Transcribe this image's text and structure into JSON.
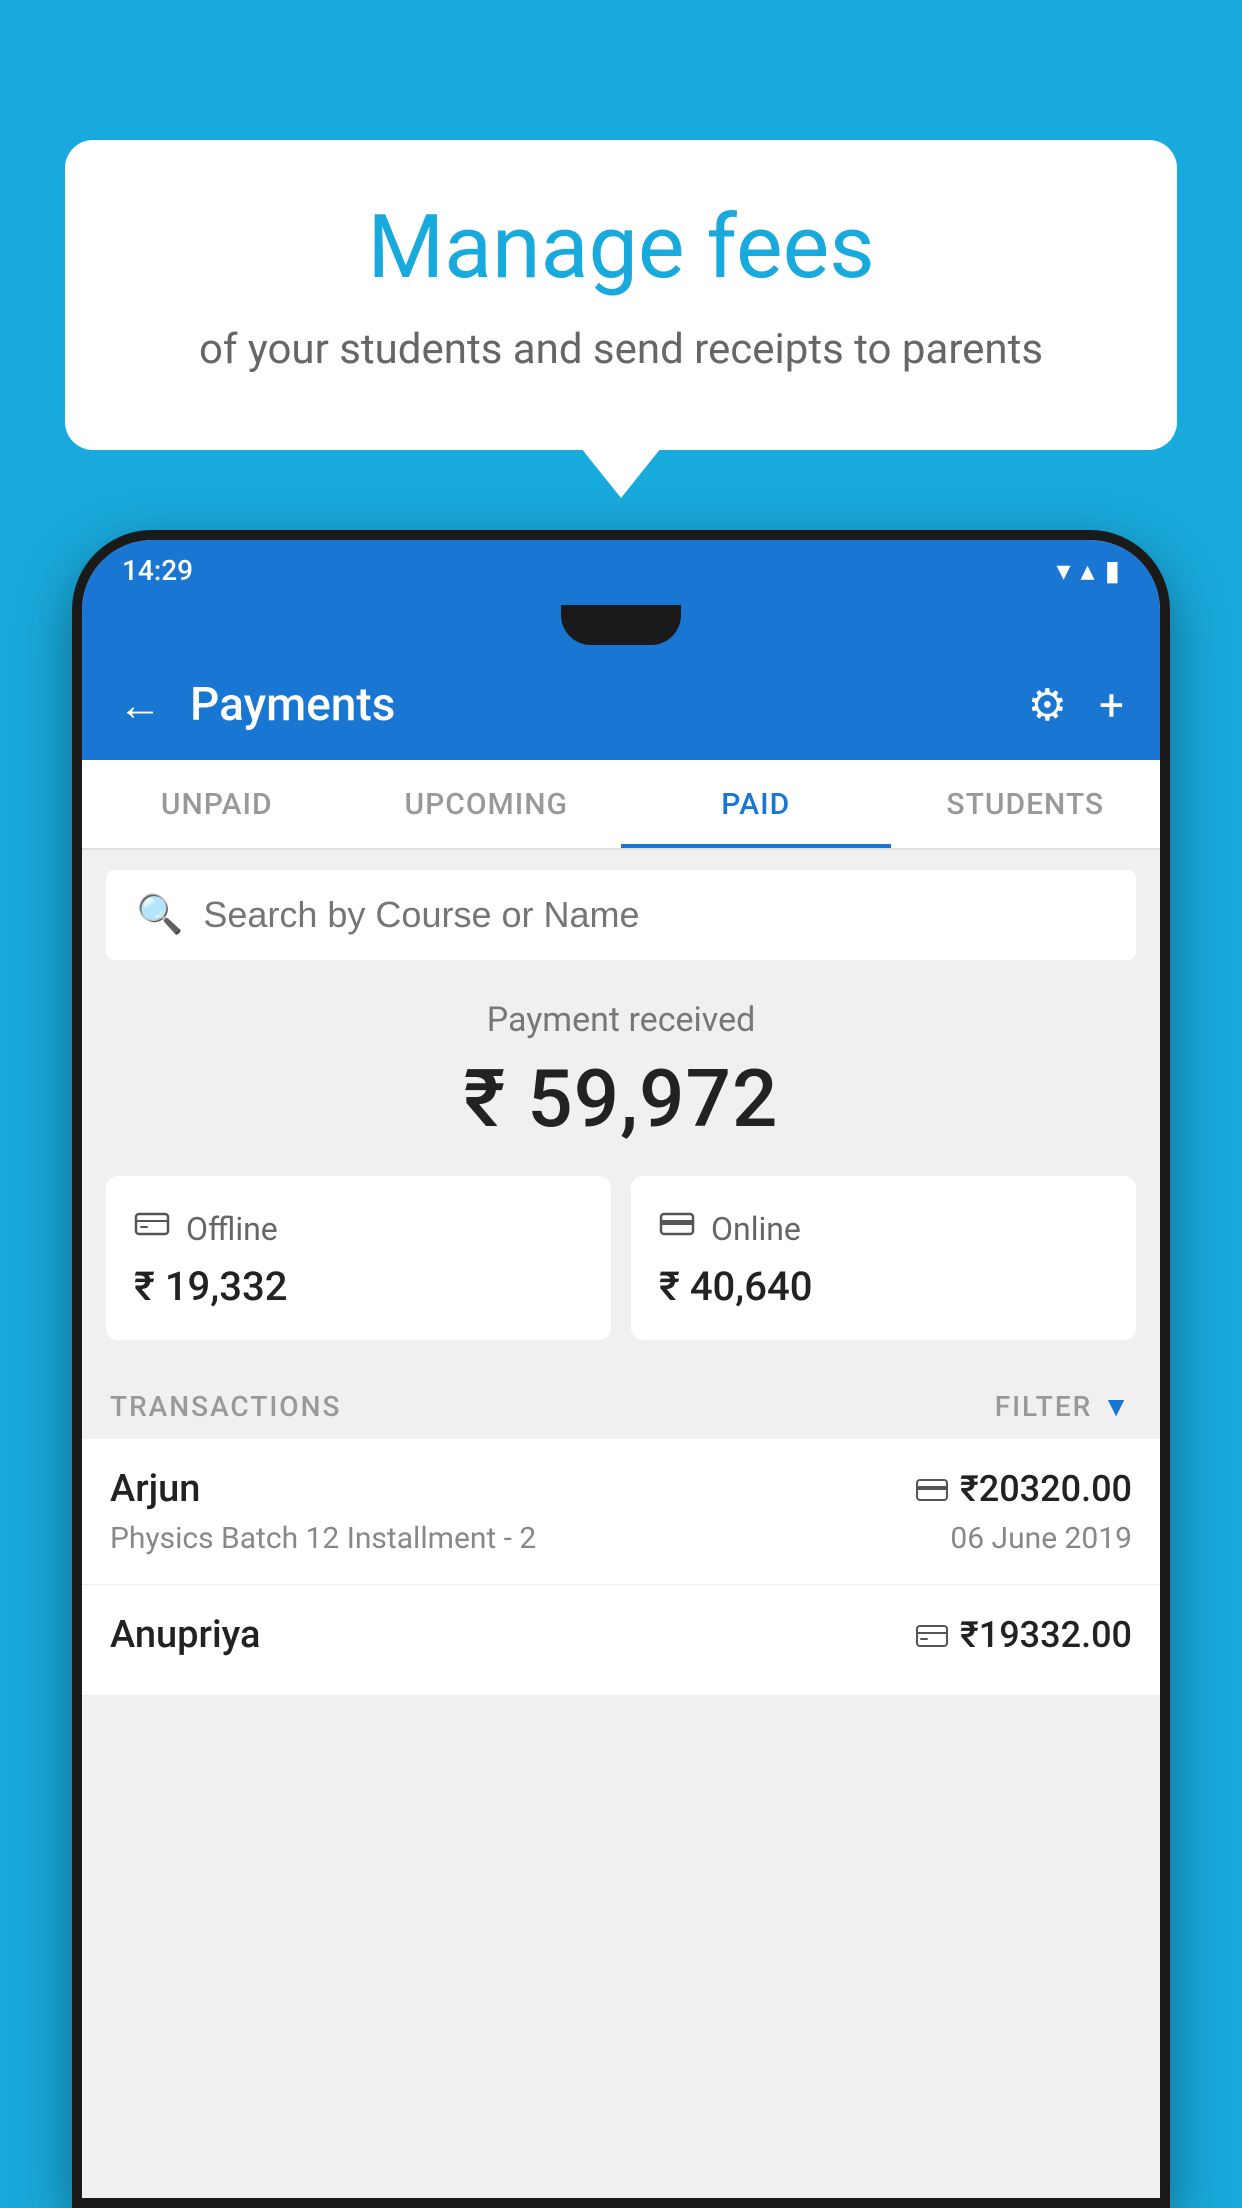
{
  "background_color": "#19AADD",
  "bubble": {
    "title": "Manage fees",
    "subtitle": "of your students and send receipts to parents"
  },
  "status_bar": {
    "time": "14:29",
    "icons": "▾▴▮"
  },
  "header": {
    "title": "Payments",
    "back_label": "←",
    "settings_label": "⚙",
    "add_label": "+"
  },
  "tabs": [
    {
      "label": "UNPAID",
      "active": false
    },
    {
      "label": "UPCOMING",
      "active": false
    },
    {
      "label": "PAID",
      "active": true
    },
    {
      "label": "STUDENTS",
      "active": false
    }
  ],
  "search": {
    "placeholder": "Search by Course or Name"
  },
  "payment_summary": {
    "label": "Payment received",
    "amount": "₹ 59,972",
    "offline": {
      "icon": "💳",
      "label": "Offline",
      "amount": "₹ 19,332"
    },
    "online": {
      "icon": "💳",
      "label": "Online",
      "amount": "₹ 40,640"
    }
  },
  "transactions_label": "TRANSACTIONS",
  "filter_label": "FILTER",
  "transactions": [
    {
      "name": "Arjun",
      "amount": "₹20320.00",
      "course": "Physics Batch 12 Installment - 2",
      "date": "06 June 2019",
      "payment_type": "online"
    },
    {
      "name": "Anupriya",
      "amount": "₹19332.00",
      "course": "",
      "date": "",
      "payment_type": "offline"
    }
  ]
}
